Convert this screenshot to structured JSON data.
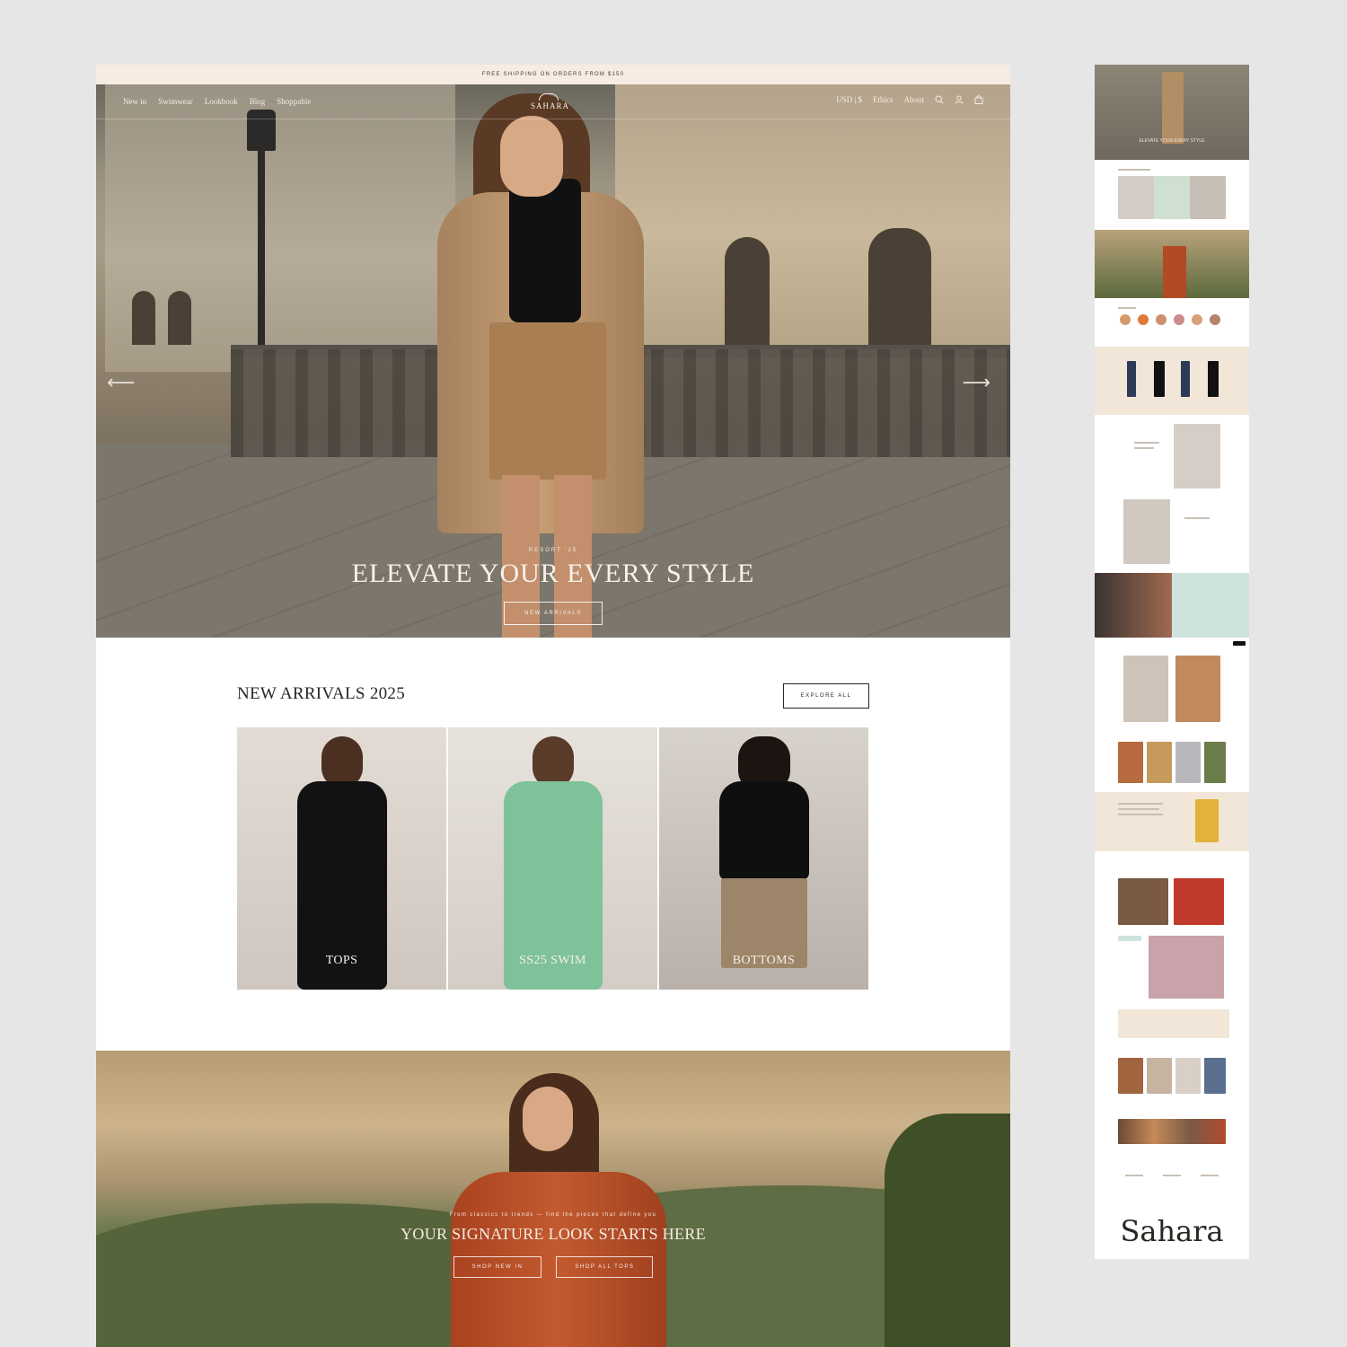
{
  "announcement": "FREE SHIPPING ON ORDERS FROM $150",
  "nav": {
    "left": [
      "New in",
      "Swimwear",
      "Lookbook",
      "Blog",
      "Shoppable"
    ],
    "logo": "SAHARA",
    "currency": "USD | $",
    "right": [
      "Ethics",
      "About"
    ]
  },
  "hero": {
    "eyebrow": "RESORT '25",
    "title": "ELEVATE YOUR EVERY STYLE",
    "button": "NEW ARRIVALS",
    "prev_arrow": "⟵",
    "next_arrow": "⟶"
  },
  "new_arrivals": {
    "title": "NEW ARRIVALS 2025",
    "explore_button": "EXPLORE ALL",
    "cards": [
      {
        "label": "TOPS"
      },
      {
        "label": "SS25 SWIM"
      },
      {
        "label": "BOTTOMS"
      }
    ]
  },
  "signature": {
    "subtitle": "From classics to trends — find the pieces that define you",
    "title": "YOUR SIGNATURE LOOK STARTS HERE",
    "buttons": [
      "SHOP NEW IN",
      "SHOP ALL TOPS"
    ]
  },
  "thumbnail": {
    "hero_caption": "ELEVATE YOUR EVERY STYLE",
    "footer_logo": "Sahara"
  },
  "colors": {
    "background": "#e6e6e6",
    "announcement_bg": "#f6ece2",
    "accent_beige": "#f1e6d8",
    "accent_mint": "#cfe3de",
    "text_dark": "#2a2622"
  },
  "icons": [
    "search-icon",
    "account-icon",
    "bag-icon",
    "arrow-left-icon",
    "arrow-right-icon"
  ]
}
